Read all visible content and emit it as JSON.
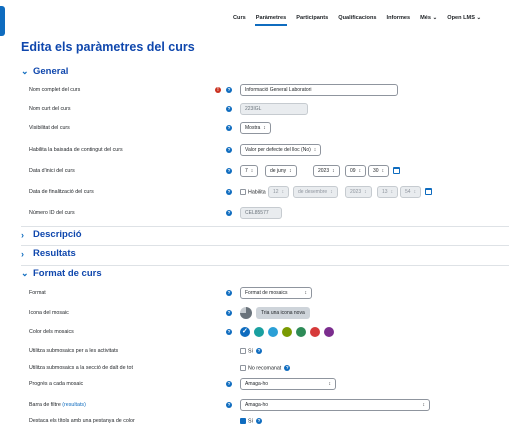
{
  "nav": {
    "tabs": [
      {
        "label": "Curs"
      },
      {
        "label": "Paràmetres"
      },
      {
        "label": "Participants"
      },
      {
        "label": "Qualificacions"
      },
      {
        "label": "Informes"
      },
      {
        "label": "Més ⌄"
      },
      {
        "label": "Open LMS ⌄"
      }
    ]
  },
  "page": {
    "title": "Edita els paràmetres del curs"
  },
  "sections": {
    "general": "General",
    "descripcio": "Descripció",
    "resultats": "Resultats",
    "format": "Format de curs"
  },
  "general": {
    "fullname_label": "Nom complet del curs",
    "fullname_value": "Informació General Laboratori",
    "shortname_label": "Nom curt del curs",
    "shortname_value": "223IGL",
    "visibility_label": "Visibilitat del curs",
    "visibility_value": "Mostra",
    "download_label": "Habilita la baixada de contingut del curs",
    "download_value": "Valor per defecte del lloc (No)",
    "start_label": "Data d'inici del curs",
    "start_day": "7",
    "start_month": "de juny",
    "start_year": "2023",
    "start_hour": "09",
    "start_min": "30",
    "end_label": "Data de finalització del curs",
    "end_enable": "Habilita",
    "end_day": "12",
    "end_month": "de desembre",
    "end_year": "2023",
    "end_hour": "13",
    "end_min": "54",
    "idnumber_label": "Número ID del curs",
    "idnumber_value": "CEL85577"
  },
  "format": {
    "format_label": "Format",
    "format_value": "Format de mosaics",
    "icon_label": "Icona del mosaic",
    "icon_button": "Tria una icona nova",
    "color_label": "Color dels mosaics",
    "colors": [
      "#0f6cbf",
      "#1aa0a0",
      "#2a9fd6",
      "#7a9a01",
      "#2e8b57",
      "#d63a3a",
      "#7b2d8e"
    ],
    "subtiles_label": "Utilitza submosaics per a les activitats",
    "subtiles_value": "Sí",
    "subtiles_top_label": "Utilitza submosaics a la secció de dalt de tot",
    "subtiles_top_value": "No recomanat",
    "progress_label": "Progrés a cada mosaic",
    "progress_value": "Amaga-ho",
    "filter_label": "Barra de filtre",
    "filter_link": "(resultats)",
    "filter_value": "Amaga-ho",
    "highlight_label": "Destaca els títols amb una pestanya de color",
    "highlight_value": "Sí"
  }
}
